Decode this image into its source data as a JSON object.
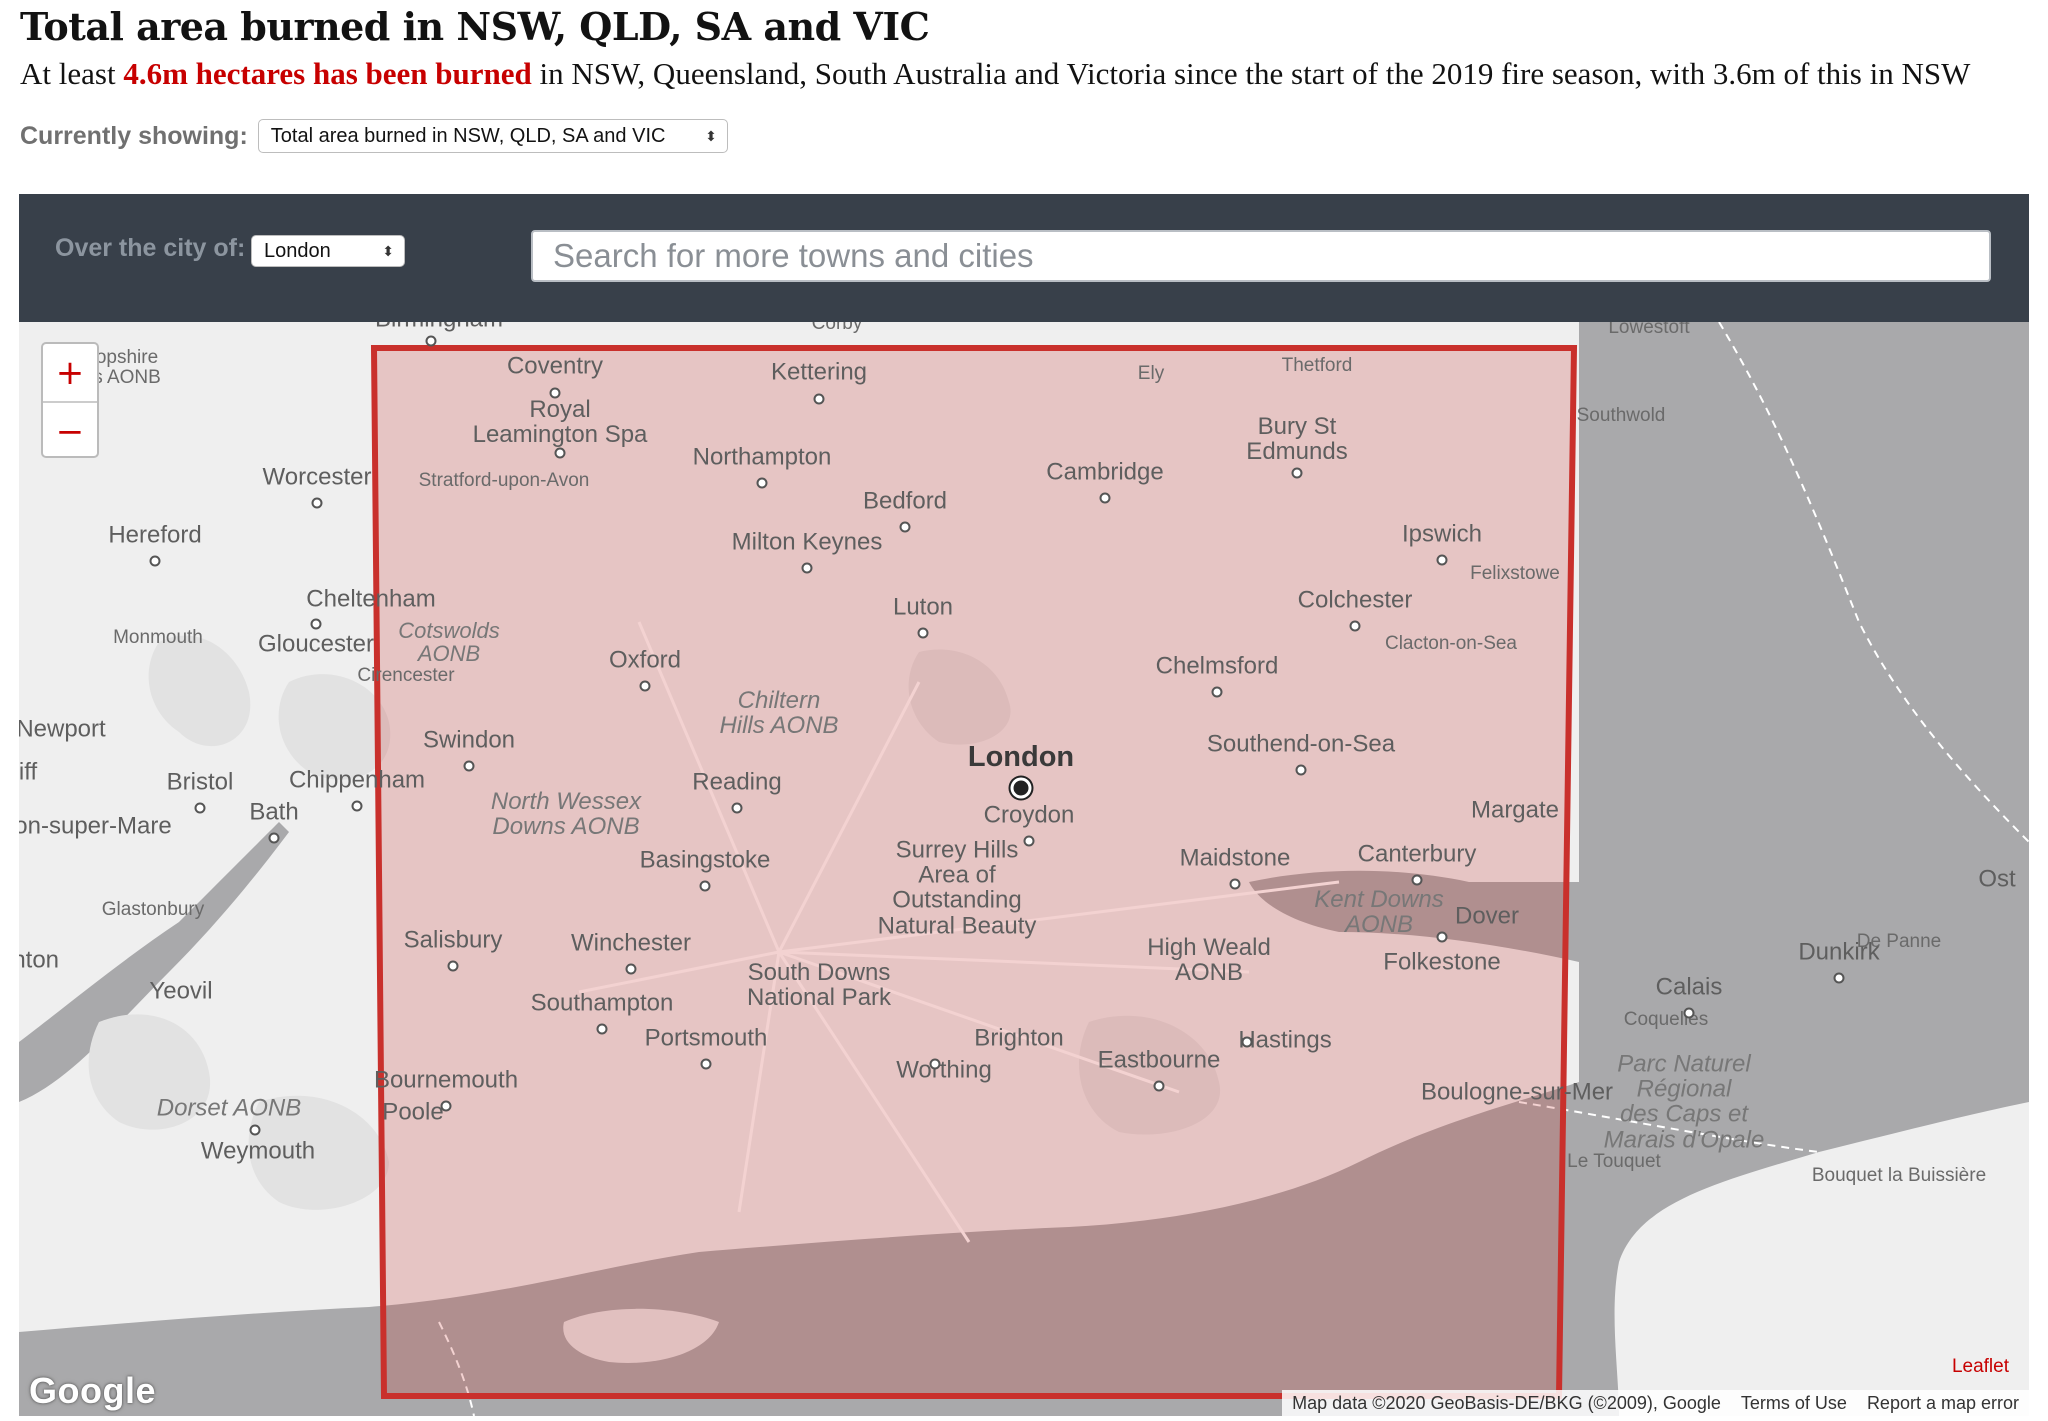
{
  "header": {
    "title": "Total area burned in NSW, QLD, SA and VIC",
    "standfirst_pre": "At least ",
    "standfirst_highlight": "4.6m hectares has been burned",
    "standfirst_post": " in NSW, Queensland, South Australia and Victoria since the start of the 2019 fire season, with 3.6m of this in NSW"
  },
  "controls": {
    "showing_label": "Currently showing:",
    "showing_value": "Total area burned in NSW, QLD, SA and VIC",
    "city_label": "Over the city of:",
    "city_value": "London",
    "search_placeholder": "Search for more towns and cities"
  },
  "map": {
    "zoom_in": "+",
    "zoom_out": "−",
    "overlay_color": "#c9302c",
    "overlay_fill_color": "#e8a5a3",
    "labels": {
      "birmingham": "Birmingham",
      "corby": "Corby",
      "lowestoft": "Lowestoft",
      "shropshire": "opshire\ns AONB",
      "coventry": "Coventry",
      "kettering": "Kettering",
      "ely": "Ely",
      "thetford": "Thetford",
      "southwold": "Southwold",
      "royal_leamington": "Royal\nLeamington Spa",
      "northampton": "Northampton",
      "bury": "Bury St\nEdmunds",
      "cambridge": "Cambridge",
      "worcester": "Worcester",
      "stratford": "Stratford-upon-Avon",
      "bedford": "Bedford",
      "hereford": "Hereford",
      "milton_keynes": "Milton Keynes",
      "ipswich": "Ipswich",
      "felixstowe": "Felixstowe",
      "cheltenham": "Cheltenham",
      "luton": "Luton",
      "colchester": "Colchester",
      "monmouth": "Monmouth",
      "gloucester": "Gloucester",
      "cotswolds": "Cotswolds\nAONB",
      "clacton": "Clacton-on-Sea",
      "oxford": "Oxford",
      "cirencester": "Cirencester",
      "chelmsford": "Chelmsford",
      "newport": "Newport",
      "chiltern": "Chiltern\nHills AONB",
      "swindon": "Swindon",
      "southend": "Southend-on-Sea",
      "london": "London",
      "iff": "iff",
      "bristol": "Bristol",
      "chippenham": "Chippenham",
      "reading": "Reading",
      "north_wessex": "North Wessex\nDowns AONB",
      "margate": "Margate",
      "bath": "Bath",
      "croydon": "Croydon",
      "weston": "on-super-Mare",
      "basingstoke": "Basingstoke",
      "surrey_hills": "Surrey Hills\nArea of\nOutstanding\nNatural Beauty",
      "maidstone": "Maidstone",
      "canterbury": "Canterbury",
      "ost": "Ost",
      "glastonbury": "Glastonbury",
      "kent_downs": "Kent Downs\nAONB",
      "dover": "Dover",
      "salisbury": "Salisbury",
      "winchester": "Winchester",
      "de_panne": "De Panne",
      "dunkirk": "Dunkirk",
      "high_weald": "High Weald\nAONB",
      "folkestone": "Folkestone",
      "taunton": "unton",
      "south_downs": "South Downs\nNational Park",
      "calais": "Calais",
      "yeovil": "Yeovil",
      "coquelles": "Coquelles",
      "southampton": "Southampton",
      "portsmouth": "Portsmouth",
      "brighton": "Brighton",
      "hastings": "Hastings",
      "eastbourne": "Eastbourne",
      "worthing": "Worthing",
      "bournemouth": "Bournemouth",
      "parc": "Parc Naturel\nRégional\ndes Caps et\nMarais d'Opale",
      "dorset": "Dorset AONB",
      "poole": "Poole",
      "boulogne": "Boulogne-sur-Mer",
      "weymouth": "Weymouth",
      "le_touquet": "Le Touquet",
      "buisson": "Bouquet la Buissière"
    },
    "google_logo": "Google",
    "leaflet": "Leaflet",
    "attribution": "Map data ©2020 GeoBasis-DE/BKG (©2009), Google",
    "terms": "Terms of Use",
    "report": "Report a map error"
  }
}
